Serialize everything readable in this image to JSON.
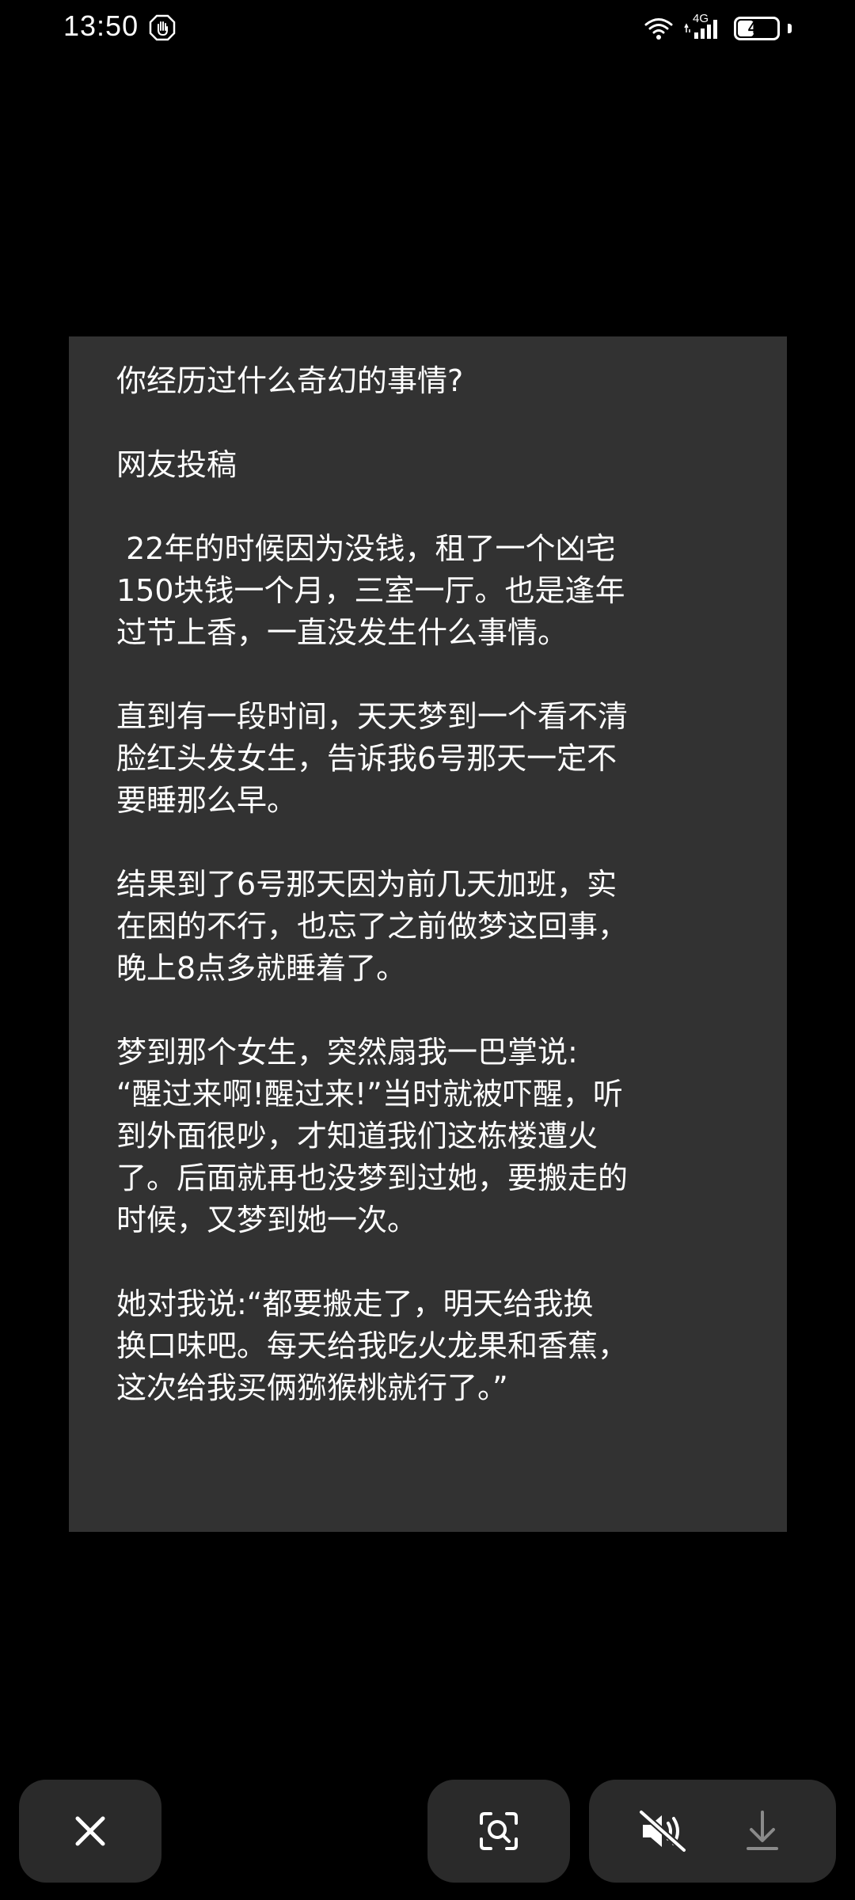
{
  "status_bar": {
    "time": "13:50",
    "network": "4G",
    "battery": "46",
    "battery_level": 0.46,
    "icons": [
      "notification-hand-icon",
      "wifi-icon",
      "signal-icon",
      "battery-icon"
    ]
  },
  "card": {
    "paragraphs": [
      "你经历过什么奇幻的事情?",
      "网友投稿",
      " 22年的时候因为没钱，租了一个凶宅\n150块钱一个月，三室一厅。也是逢年\n过节上香，一直没发生什么事情。",
      "直到有一段时间，天天梦到一个看不清\n脸红头发女生，告诉我6号那天一定不\n要睡那么早。",
      "结果到了6号那天因为前几天加班，实\n在困的不行，也忘了之前做梦这回事，\n晚上8点多就睡着了。",
      "梦到那个女生，突然扇我一巴掌说:\n“醒过来啊!醒过来!”当时就被吓醒，听\n到外面很吵，才知道我们这栋楼遭火\n了。后面就再也没梦到过她，要搬走的\n时候，又梦到她一次。",
      "她对我说:“都要搬走了，明天给我换\n换口味吧。每天给我吃火龙果和香蕉，\n这次给我买俩猕猴桃就行了。”"
    ]
  },
  "controls": {
    "icons": [
      "close-icon",
      "lens-search-icon",
      "mute-icon",
      "download-icon"
    ],
    "background": "#2a2a2a"
  }
}
